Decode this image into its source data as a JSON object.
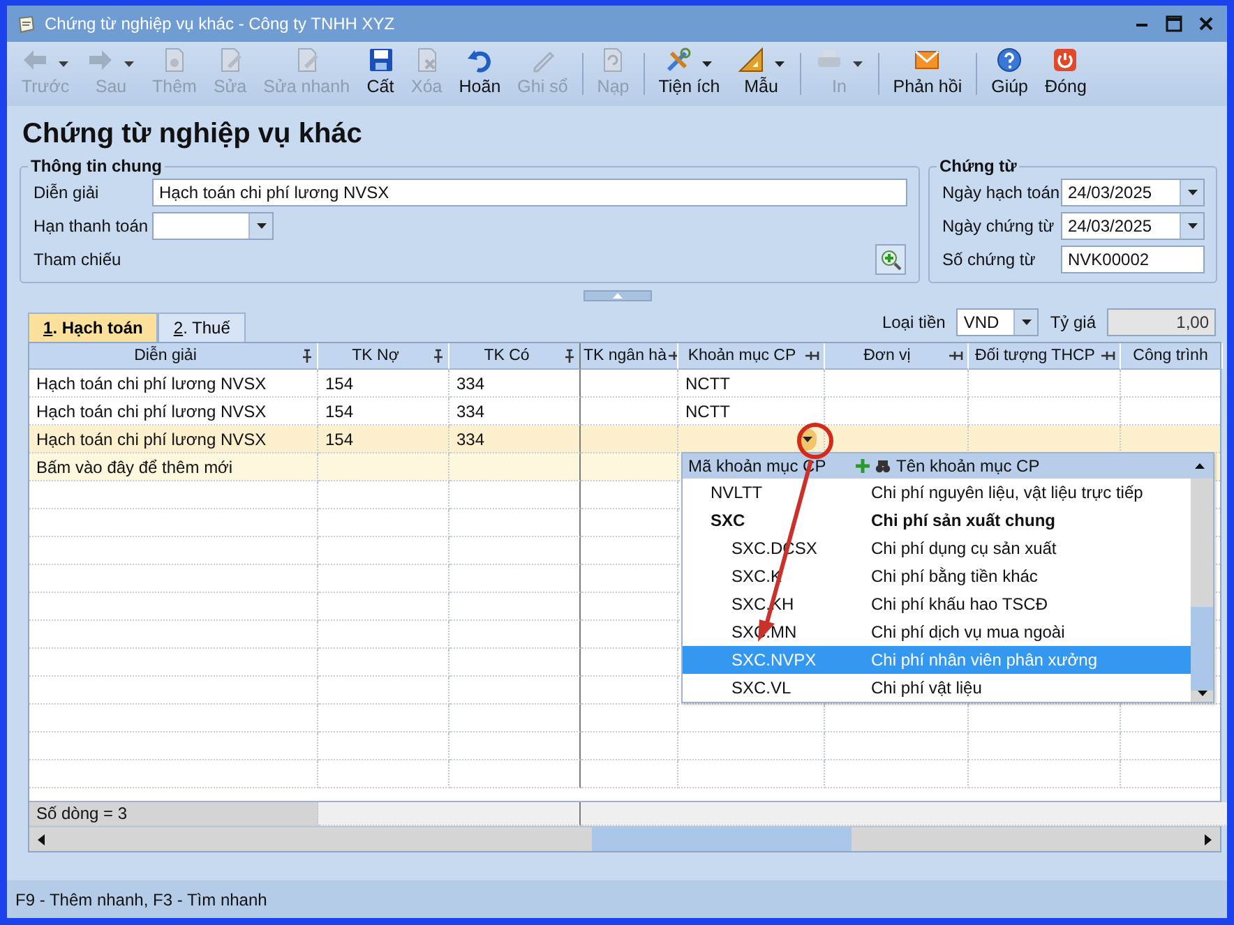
{
  "window": {
    "title": "Chứng từ nghiệp vụ khác - Công ty TNHH XYZ"
  },
  "toolbar": [
    {
      "kind": "button",
      "label": "Trước",
      "disabled": true,
      "menu": true
    },
    {
      "kind": "button",
      "label": "Sau",
      "disabled": true,
      "menu": true
    },
    {
      "kind": "button",
      "label": "Thêm",
      "disabled": true,
      "menu": false
    },
    {
      "kind": "button",
      "label": "Sửa",
      "disabled": true,
      "menu": false
    },
    {
      "kind": "button",
      "label": "Sửa nhanh",
      "disabled": true,
      "menu": false
    },
    {
      "kind": "button",
      "label": "Cất",
      "disabled": false,
      "menu": false
    },
    {
      "kind": "button",
      "label": "Xóa",
      "disabled": true,
      "menu": false
    },
    {
      "kind": "button",
      "label": "Hoãn",
      "disabled": false,
      "menu": false
    },
    {
      "kind": "button",
      "label": "Ghi sổ",
      "disabled": true,
      "menu": false
    },
    {
      "kind": "separator"
    },
    {
      "kind": "button",
      "label": "Nạp",
      "disabled": true,
      "menu": false
    },
    {
      "kind": "separator"
    },
    {
      "kind": "button",
      "label": "Tiện ích",
      "disabled": false,
      "menu": true
    },
    {
      "kind": "button",
      "label": "Mẫu",
      "disabled": false,
      "menu": true
    },
    {
      "kind": "separator"
    },
    {
      "kind": "button",
      "label": "In",
      "disabled": true,
      "menu": true
    },
    {
      "kind": "separator"
    },
    {
      "kind": "button",
      "label": "Phản hồi",
      "disabled": false,
      "menu": false
    },
    {
      "kind": "separator"
    },
    {
      "kind": "button",
      "label": "Giúp",
      "disabled": false,
      "menu": false
    },
    {
      "kind": "button",
      "label": "Đóng",
      "disabled": false,
      "menu": false
    }
  ],
  "heading": "Chứng từ nghiệp vụ khác",
  "general_info": {
    "title": "Thông tin chung",
    "fields": [
      {
        "kind": "text",
        "label": "Diễn giải",
        "value": "Hạch toán chi phí lương NVSX"
      },
      {
        "kind": "combo",
        "label": "Hạn thanh toán"
      },
      {
        "kind": "lookup",
        "label": "Tham chiếu"
      }
    ]
  },
  "voucher": {
    "title": "Chứng từ",
    "fields": [
      {
        "kind": "combo",
        "label": "Ngày hạch toán",
        "value": "24/03/2025"
      },
      {
        "kind": "combo",
        "label": "Ngày chứng từ",
        "value": "24/03/2025"
      },
      {
        "kind": "text",
        "label": "Số chứng từ",
        "value": "NVK00002"
      }
    ]
  },
  "tabs": [
    {
      "label": "1. Hạch toán",
      "selected": true
    },
    {
      "label": "2. Thuế",
      "selected": false
    }
  ],
  "currency": {
    "label": "Loại tiền",
    "value": "VND"
  },
  "rate": {
    "label": "Tỷ giá",
    "value": "1,00",
    "disabled": true
  },
  "grid": {
    "columns": [
      {
        "label": "Diễn giải",
        "pinned": true
      },
      {
        "label": "TK Nợ",
        "pinned": true
      },
      {
        "label": "TK Có",
        "pinned": true
      },
      {
        "label": "TK ngân hà",
        "pinned": false
      },
      {
        "label": "Khoản mục CP",
        "pinned": false
      },
      {
        "label": "Đơn vị",
        "pinned": false
      },
      {
        "label": "Đối tượng THCP",
        "pinned": false
      },
      {
        "label": "Công trình",
        "pinned": false
      }
    ],
    "rows": [
      {
        "description": "Hạch toán chi phí lương NVSX",
        "debit_account": "154",
        "credit_account": "334",
        "expense_item": "NCTT",
        "current": false
      },
      {
        "description": "Hạch toán chi phí lương NVSX",
        "debit_account": "154",
        "credit_account": "334",
        "expense_item": "NCTT",
        "current": false
      },
      {
        "description": "Hạch toán chi phí lương NVSX",
        "debit_account": "154",
        "credit_account": "334",
        "current": true
      }
    ],
    "new_row": "Bấm vào đây để thêm mới",
    "footer": "Số dòng = 3"
  },
  "dropdown": {
    "columns": [
      "Mã khoản mục CP",
      "Tên khoản mục CP"
    ],
    "items": [
      {
        "code": "NVLTT",
        "name": "Chi phí nguyên liệu, vật liệu trực tiếp",
        "selected": false
      },
      {
        "code": "SXC",
        "name": "Chi phí sản xuất chung",
        "selected": false,
        "children": [
          {
            "code": "SXC.DCSX",
            "name": "Chi phí dụng cụ sản xuất",
            "selected": false
          },
          {
            "code": "SXC.K",
            "name": "Chi phí bằng tiền khác",
            "selected": false
          },
          {
            "code": "SXC.KH",
            "name": "Chi phí khấu hao TSCĐ",
            "selected": false
          },
          {
            "code": "SXC.MN",
            "name": "Chi phí dịch vụ mua ngoài",
            "selected": false
          },
          {
            "code": "SXC.NVPX",
            "name": "Chi phí nhân viên phân xưởng",
            "selected": true
          },
          {
            "code": "SXC.VL",
            "name": "Chi phí vật liệu",
            "selected": false
          }
        ]
      }
    ]
  },
  "status_bar": "F9 - Thêm nhanh, F3 - Tìm nhanh"
}
